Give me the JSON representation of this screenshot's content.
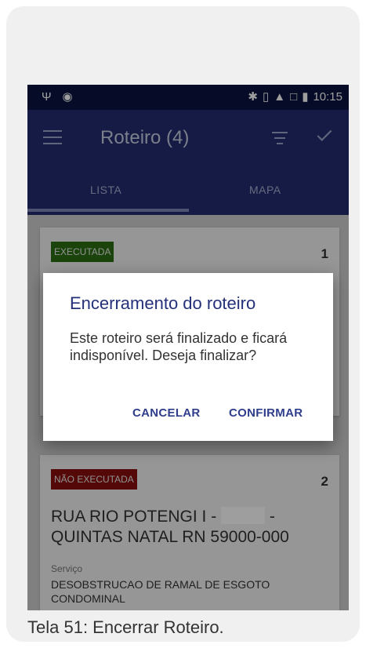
{
  "statusbar": {
    "time": "10:15"
  },
  "appbar": {
    "title": "Roteiro (4)"
  },
  "tabs": [
    {
      "label": "LISTA"
    },
    {
      "label": "MAPA"
    }
  ],
  "cards": [
    {
      "status": "EXECUTADA",
      "number": "1"
    },
    {
      "status": "NÃO EXECUTADA",
      "number": "2",
      "address_line1_start": "RUA RIO POTENGI I -",
      "address_line1_end": "-",
      "address_line2": "QUINTAS NATAL RN 59000-000",
      "service_label": "Serviço",
      "service_value": "DESOBSTRUCAO DE RAMAL DE ESGOTO CONDOMINAL"
    }
  ],
  "dialog": {
    "title": "Encerramento do roteiro",
    "message": "Este roteiro será finalizado e ficará indisponível. Deseja finalizar?",
    "cancel_label": "CANCELAR",
    "confirm_label": "CONFIRMAR"
  },
  "caption": "Tela 51: Encerrar Roteiro.",
  "colors": {
    "appbar": "#232c6e",
    "statusbar": "#0a1440",
    "executada": "#2c6e16",
    "nao_executada": "#8a0d0d",
    "accent": "#2f3d8c"
  }
}
